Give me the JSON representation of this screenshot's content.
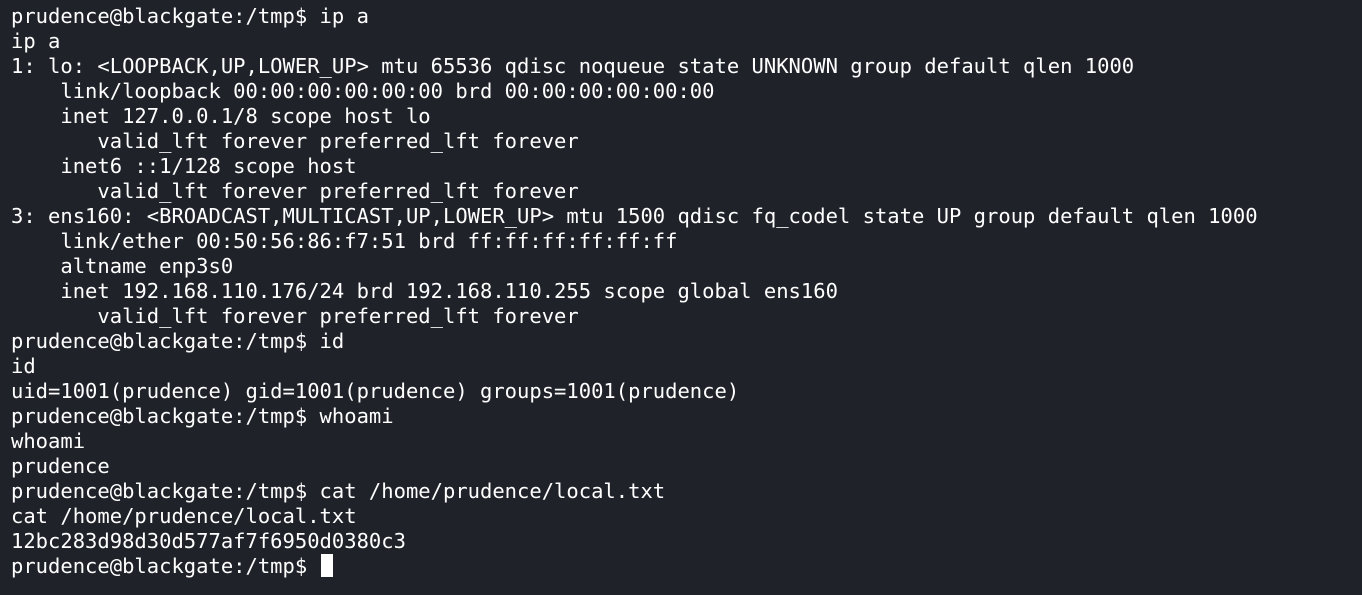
{
  "terminal": {
    "lines": [
      "prudence@blackgate:/tmp$ ip a",
      "ip a",
      "1: lo: <LOOPBACK,UP,LOWER_UP> mtu 65536 qdisc noqueue state UNKNOWN group default qlen 1000",
      "    link/loopback 00:00:00:00:00:00 brd 00:00:00:00:00:00",
      "    inet 127.0.0.1/8 scope host lo",
      "       valid_lft forever preferred_lft forever",
      "    inet6 ::1/128 scope host",
      "       valid_lft forever preferred_lft forever",
      "3: ens160: <BROADCAST,MULTICAST,UP,LOWER_UP> mtu 1500 qdisc fq_codel state UP group default qlen 1000",
      "    link/ether 00:50:56:86:f7:51 brd ff:ff:ff:ff:ff:ff",
      "    altname enp3s0",
      "    inet 192.168.110.176/24 brd 192.168.110.255 scope global ens160",
      "       valid_lft forever preferred_lft forever",
      "prudence@blackgate:/tmp$ id",
      "id",
      "uid=1001(prudence) gid=1001(prudence) groups=1001(prudence)",
      "prudence@blackgate:/tmp$ whoami",
      "whoami",
      "prudence",
      "prudence@blackgate:/tmp$ cat /home/prudence/local.txt",
      "cat /home/prudence/local.txt",
      "12bc283d98d30d577af7f6950d0380c3"
    ],
    "prompt": "prudence@blackgate:/tmp$ ",
    "colors": {
      "background": "#1f2229",
      "foreground": "#ffffff"
    }
  }
}
